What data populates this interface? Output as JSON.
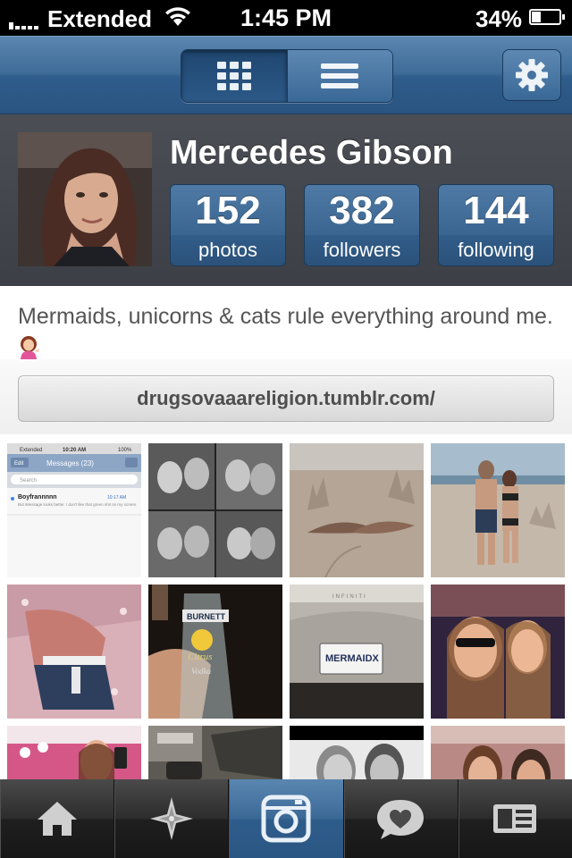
{
  "status_bar": {
    "carrier": "Extended",
    "time": "1:45 PM",
    "battery": "34%"
  },
  "nav": {
    "view_toggle": [
      "grid-view",
      "list-view"
    ],
    "active_view": "grid-view",
    "settings_icon": "gear-icon"
  },
  "profile": {
    "name": "Mercedes Gibson",
    "stats": [
      {
        "value": "152",
        "label": "photos"
      },
      {
        "value": "382",
        "label": "followers"
      },
      {
        "value": "144",
        "label": "following"
      }
    ],
    "bio": "Mermaids, unicorns & cats rule everything around me.",
    "website": "drugsovaaareligion.tumblr.com/"
  },
  "thumb1": {
    "carrier": "Extended",
    "time": "10:20 AM",
    "battery": "100%",
    "edit": "Edit",
    "title": "Messages (23)",
    "search": "Search",
    "contact": "Boyfrannnnn",
    "contact_time": "10:17 AM",
    "preview": "But iMessage looks better. I don't like that green shit on my screen."
  },
  "thumb6": {
    "bottle_brand": "BURNETT",
    "bottle_flavor": "Citrus",
    "bottle_type": "Vodka"
  },
  "thumb7": {
    "plate": "MERMAIDX",
    "brand": "INFINITI"
  },
  "tab_bar": {
    "tabs": [
      "home-icon",
      "explore-icon",
      "camera-icon",
      "activity-icon",
      "profile-icon"
    ],
    "active": "camera-icon"
  },
  "colors": {
    "nav_blue": "#3e6b98",
    "header_gray": "#43474d",
    "tab_dark": "#222222"
  }
}
